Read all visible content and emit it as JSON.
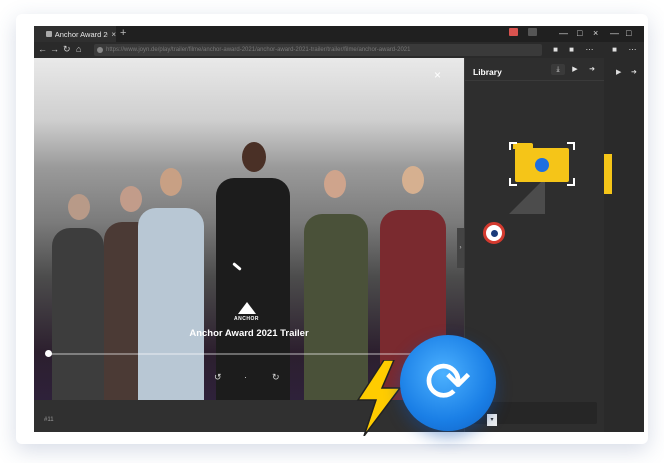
{
  "window": {
    "tab_title": "Anchor Award 2021 Tr",
    "tab_close": "×",
    "new_tab": "+",
    "minimize": "—",
    "maximize": "□",
    "close": "×"
  },
  "toolbar": {
    "back": "←",
    "forward": "→",
    "refresh": "↻",
    "home": "⌂",
    "url": "https://www.joyn.de/play/trailer/filme/anchor-award-2021/anchor-award-2021-trailer/trailer/filme/anchor-award-2021"
  },
  "video": {
    "close_label": "×",
    "logo_text": "ANCHOR",
    "title": "Anchor Award 2021 Trailer",
    "progress": 0.0,
    "rewind": "↺",
    "dot": "·",
    "forward": "↻",
    "side_handle": "›"
  },
  "bottombar": {
    "label": "#11"
  },
  "library": {
    "title": "Library",
    "download_icon": "⤓",
    "youtube_icon": "▶",
    "arrow_icon": "➜"
  },
  "rightstrip": {
    "youtube_icon": "▶",
    "arrow_icon": "➜"
  },
  "badge": {
    "icon": "⟳"
  },
  "colors": {
    "accent": "#1a7fe6",
    "folder": "#f5c518",
    "bolt": "#ffcc00",
    "app_bg": "#2b2b2b"
  }
}
